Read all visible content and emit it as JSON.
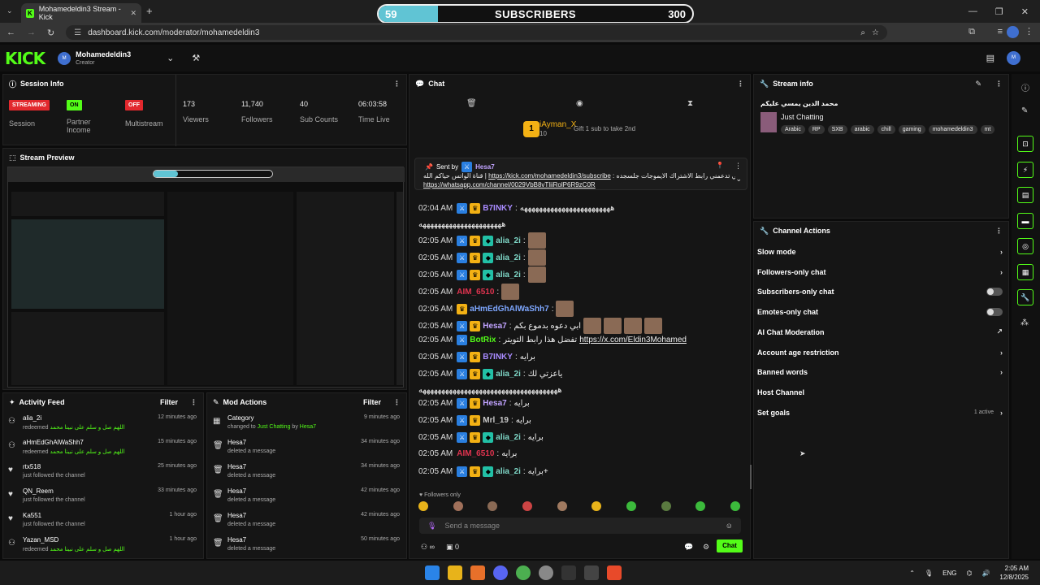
{
  "browser": {
    "tab_title": "Mohamedeldin3 Stream - Kick",
    "url": "dashboard.kick.com/moderator/mohamedeldin3"
  },
  "overlay": {
    "current": "59",
    "label": "SUBSCRIBERS",
    "goal": "300",
    "progress": 0.19
  },
  "header": {
    "logo": "KICK",
    "channel": "Mohamedeldin3",
    "role": "Creator",
    "avatar_initials": "M"
  },
  "session": {
    "title": "Session Info",
    "streaming": "STREAMING",
    "session_label": "Session",
    "partner_badge": "ON",
    "partner_label": "Partner Income",
    "multistream_badge": "OFF",
    "multistream_label": "Multistream",
    "stats": [
      {
        "value": "173",
        "label": "Viewers"
      },
      {
        "value": "11,740",
        "label": "Followers"
      },
      {
        "value": "40",
        "label": "Sub Counts"
      },
      {
        "value": "06:03:58",
        "label": "Time Live"
      }
    ]
  },
  "preview": {
    "title": "Stream Preview"
  },
  "activity": {
    "title": "Activity Feed",
    "filter": "Filter",
    "items": [
      {
        "name": "alia_2i",
        "desc": "redeemed",
        "extra": "اللهم صل و سلم على نبينا محمد",
        "time": "12 minutes ago",
        "icon": "redeem"
      },
      {
        "name": "aHmEdGhAlWaShh7",
        "desc": "redeemed",
        "extra": "اللهم صل و سلم على نبينا محمد",
        "time": "15 minutes ago",
        "icon": "redeem"
      },
      {
        "name": "rtx518",
        "desc": "just followed the channel",
        "extra": "",
        "time": "25 minutes ago",
        "icon": "heart"
      },
      {
        "name": "QN_Reem",
        "desc": "just followed the channel",
        "extra": "",
        "time": "33 minutes ago",
        "icon": "heart"
      },
      {
        "name": "Ka551",
        "desc": "just followed the channel",
        "extra": "",
        "time": "1 hour ago",
        "icon": "heart"
      },
      {
        "name": "Yazan_MSD",
        "desc": "redeemed",
        "extra": "اللهم صل و سلم على نبينا محمد",
        "time": "1 hour ago",
        "icon": "redeem"
      }
    ]
  },
  "mod": {
    "title": "Mod Actions",
    "filter": "Filter",
    "items": [
      {
        "name": "Category",
        "desc": "changed to",
        "cat": "Just Chatting",
        "by": "by",
        "who": "Hesa7",
        "time": "9 minutes ago"
      },
      {
        "name": "Hesa7",
        "desc": "deleted a message",
        "time": "34 minutes ago"
      },
      {
        "name": "Hesa7",
        "desc": "deleted a message",
        "time": "34 minutes ago"
      },
      {
        "name": "Hesa7",
        "desc": "deleted a message",
        "time": "42 minutes ago"
      },
      {
        "name": "Hesa7",
        "desc": "deleted a message",
        "time": "42 minutes ago"
      },
      {
        "name": "Hesa7",
        "desc": "deleted a message",
        "time": "50 minutes ago"
      }
    ]
  },
  "chat": {
    "title": "Chat",
    "gifter": "iAyman_X",
    "gift_count": "10",
    "gift_text": "Gift 1 sub to take 2nd",
    "pinned": {
      "sent_by": "Sent by",
      "who": "Hesa7",
      "text": "قناة الواتس حياكم الله |",
      "link1": "https://kick.com/mohamedeldin3/subscribe",
      "text2": ": لنا ابي تدعمني رابط الاشتراك الايموجات جلسجده",
      "link2": "https://whatsapp.com/channel/0029VbB8vTliiRolP6R9zC0R"
    },
    "messages": [
      {
        "time": "02:04 AM",
        "user": "B7INKY",
        "color": "#a98bff",
        "text": "ههههههههههههههههههههههههه",
        "badges": "bg"
      },
      {
        "time": "",
        "user": "",
        "color": "#eee",
        "text": "ههههههههههههههههههههههه",
        "badges": ""
      },
      {
        "time": "02:05 AM",
        "user": "alia_2i",
        "color": "#7fd8c8",
        "text": "",
        "badges": "bgt",
        "emote": true
      },
      {
        "time": "02:05 AM",
        "user": "alia_2i",
        "color": "#7fd8c8",
        "text": "",
        "badges": "bgt",
        "emote": true
      },
      {
        "time": "02:05 AM",
        "user": "alia_2i",
        "color": "#7fd8c8",
        "text": "",
        "badges": "bgt",
        "emote": true
      },
      {
        "time": "02:05 AM",
        "user": "AIM_6510",
        "color": "#e0334f",
        "text": "",
        "badges": "",
        "emote": true
      },
      {
        "time": "02:05 AM",
        "user": "aHmEdGhAlWaShh7",
        "color": "#7ea7ff",
        "text": "",
        "badges": "g",
        "emote": true
      },
      {
        "time": "02:05 AM",
        "user": "Hesa7",
        "color": "#c1a3ff",
        "text": "ابي دعوه بدموع بكم",
        "badges": "bg",
        "emote": true
      },
      {
        "time": "02:05 AM",
        "user": "BotRix",
        "color": "#53fc18",
        "text": "تفضل هذا رابط التويتر",
        "link": "https://x.com/Eldin3Mohamed",
        "badges": "b"
      },
      {
        "time": "02:05 AM",
        "user": "B7INKY",
        "color": "#a98bff",
        "text": "برايه",
        "badges": "bg"
      },
      {
        "time": "02:05 AM",
        "user": "alia_2i",
        "color": "#7fd8c8",
        "text": "ياعزتي لك",
        "badges": "bgt"
      },
      {
        "time": "",
        "user": "",
        "color": "#eee",
        "text": "هههههههههههههههههههههههههههههههههههههه",
        "badges": ""
      },
      {
        "time": "02:05 AM",
        "user": "Hesa7",
        "color": "#c1a3ff",
        "text": "برايه",
        "badges": "bg"
      },
      {
        "time": "02:05 AM",
        "user": "Mrl_19",
        "color": "#c9c9c9",
        "text": "برايه",
        "badges": "bg"
      },
      {
        "time": "02:05 AM",
        "user": "alia_2i",
        "color": "#7fd8c8",
        "text": "برايه",
        "badges": "bgt"
      },
      {
        "time": "02:05 AM",
        "user": "AIM_6510",
        "color": "#e0334f",
        "text": "برايه",
        "badges": ""
      },
      {
        "time": "02:05 AM",
        "user": "alia_2i",
        "color": "#7fd8c8",
        "text": "برايه+",
        "badges": "bgt"
      }
    ],
    "followers_only": "Followers only",
    "placeholder": "Send a message",
    "count": "0",
    "send": "Chat"
  },
  "stream": {
    "title": "Stream info",
    "stream_title": "محمد الدين يمسي عليكم",
    "category": "Just Chatting",
    "tags": [
      "Arabic",
      "RP",
      "SXB",
      "arabic",
      "chill",
      "gaming",
      "mohamedeldin3",
      "mt"
    ]
  },
  "actions": {
    "title": "Channel Actions",
    "items": [
      {
        "label": "Slow mode",
        "right": "chevron"
      },
      {
        "label": "Followers-only chat",
        "right": "chevron"
      },
      {
        "label": "Subscribers-only chat",
        "right": "toggle"
      },
      {
        "label": "Emotes-only chat",
        "right": "toggle"
      },
      {
        "label": "AI Chat Moderation",
        "right": "external"
      },
      {
        "label": "Account age restriction",
        "right": "chevron"
      },
      {
        "label": "Banned words",
        "right": "chevron"
      },
      {
        "label": "Host Channel",
        "right": ""
      },
      {
        "label": "Set goals",
        "right": "chevron",
        "note": "1 active"
      }
    ]
  },
  "taskbar": {
    "lang": "ENG",
    "time": "2:05 AM",
    "date": "12/8/2025"
  }
}
